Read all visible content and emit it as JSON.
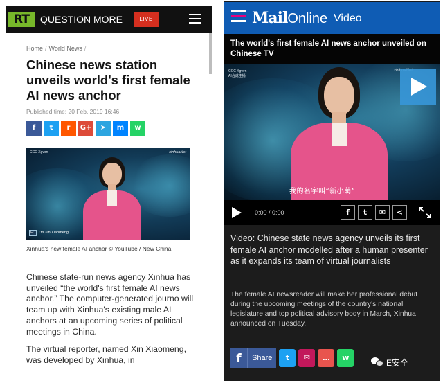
{
  "rt": {
    "logo": "RT",
    "tagline": "QUESTION MORE",
    "live_label": "LIVE",
    "breadcrumbs": [
      "Home",
      "World News"
    ],
    "crumb_sep": "/",
    "title": "Chinese news station unveils world's first female AI news anchor",
    "published": "Published time: 20 Feb, 2019 16:46",
    "share_icons": [
      {
        "icon": "facebook-icon",
        "glyph": "f",
        "color": "#3b5998"
      },
      {
        "icon": "twitter-icon",
        "glyph": "t",
        "color": "#1da1f2"
      },
      {
        "icon": "reddit-icon",
        "glyph": "r",
        "color": "#ff5700"
      },
      {
        "icon": "google-plus-icon",
        "glyph": "G+",
        "color": "#dd4b39"
      },
      {
        "icon": "telegram-icon",
        "glyph": "➤",
        "color": "#2ca5e0"
      },
      {
        "icon": "messenger-icon",
        "glyph": "m",
        "color": "#0084ff"
      },
      {
        "icon": "whatsapp-icon",
        "glyph": "w",
        "color": "#25d366"
      }
    ],
    "video": {
      "corner_logo": "CCC Xgwrn",
      "brand": "xinhuaNet",
      "caption": "I'm Xin Xiaomeng",
      "corner_badge": "FC"
    },
    "video_caption": "Xinhua's new female AI anchor © YouTube / New China",
    "paragraphs": [
      "Chinese state-run news agency Xinhua has unveiled “the world's first female AI news anchor.” The computer-generated journo will team up with Xinhua's existing male AI anchors at an upcoming series of political meetings in China.",
      "The virtual reporter, named Xin Xiaomeng, was developed by Xinhua, in"
    ]
  },
  "dm": {
    "logo_bold": "Mail",
    "logo_light": "Online",
    "section": "Video",
    "menu_colors": [
      "#ffffff",
      "#e6007e",
      "#ffffff"
    ],
    "video_title": "The world's first female AI news anchor unveiled on Chinese TV",
    "video": {
      "corner_logo": "CCC Xgwrn",
      "corner_logo2": "AI合成主播",
      "brand": "xinhuaNet",
      "subtitle": "我的名字叫“新小萌”"
    },
    "time": "0:00 / 0:00",
    "control_buttons": [
      {
        "icon": "facebook-icon",
        "glyph": "f"
      },
      {
        "icon": "twitter-icon",
        "glyph": "t"
      },
      {
        "icon": "email-icon",
        "glyph": "✉"
      },
      {
        "icon": "share-icon",
        "glyph": "<"
      }
    ],
    "headline": "Video: Chinese state news agency unveils its first female AI anchor modelled after a human presenter as it expands its team of virtual journalists",
    "description": "The female AI newsreader will make her professional debut during the upcoming meetings of the country's national legislature and top political advisory body in March, Xinhua announced on Tuesday.",
    "share_label": "Share",
    "share_icons": [
      {
        "icon": "twitter-icon",
        "glyph": "t",
        "color": "#1da1f2"
      },
      {
        "icon": "email-icon",
        "glyph": "✉",
        "color": "#c2185b"
      },
      {
        "icon": "comment-icon",
        "glyph": "…",
        "color": "#e8544e"
      },
      {
        "icon": "whatsapp-icon",
        "glyph": "w",
        "color": "#25d366"
      }
    ]
  },
  "watermark": "E安全"
}
